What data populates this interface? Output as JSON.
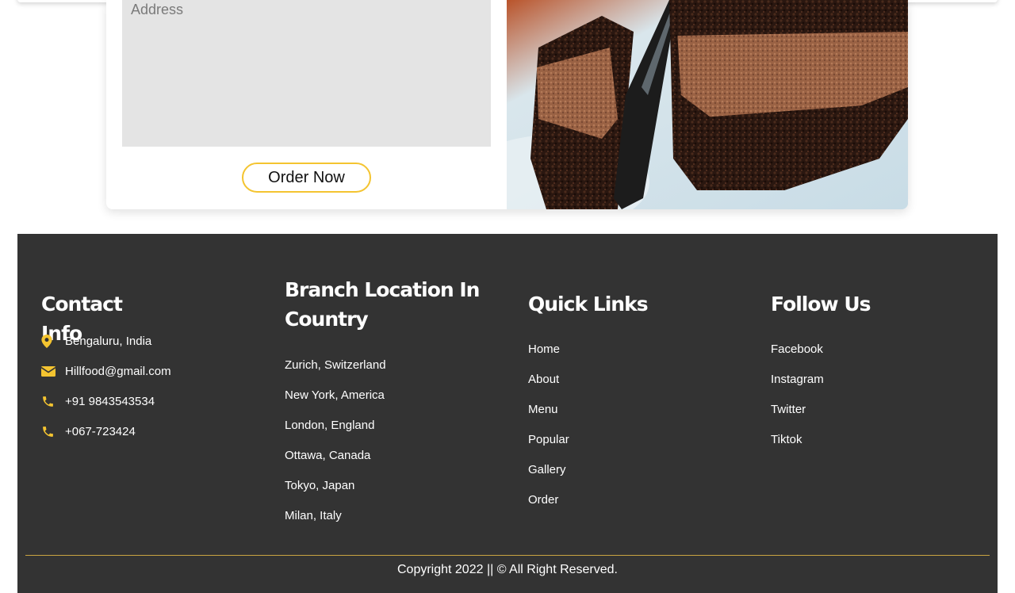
{
  "order_form": {
    "address_placeholder": "Address",
    "address_value": "",
    "order_button_label": "Order Now"
  },
  "footer": {
    "contact": {
      "title": "Contact Info",
      "items": [
        {
          "icon": "map-pin-icon",
          "text": "Bengaluru, India"
        },
        {
          "icon": "envelope-icon",
          "text": "Hillfood@gmail.com"
        },
        {
          "icon": "phone-icon",
          "text": "+91 9843543534"
        },
        {
          "icon": "phone-icon",
          "text": "+067-723424"
        }
      ]
    },
    "branches": {
      "title_line1": "Branch Location In",
      "title_line2": "Country",
      "items": [
        "Zurich, Switzerland",
        "New York, America",
        "London, England",
        "Ottawa, Canada",
        "Tokyo, Japan",
        "Milan, Italy"
      ]
    },
    "quick_links": {
      "title": "Quick Links",
      "items": [
        "Home",
        "About",
        "Menu",
        "Popular",
        "Gallery",
        "Order"
      ]
    },
    "follow": {
      "title": "Follow Us",
      "items": [
        "Facebook",
        "Instagram",
        "Twitter",
        "Tiktok"
      ]
    },
    "copyright": "Copyright 2022 || © All Right Reserved."
  },
  "colors": {
    "accent": "#f4c430",
    "footer_bg": "#333333",
    "divider": "#c9a441"
  }
}
